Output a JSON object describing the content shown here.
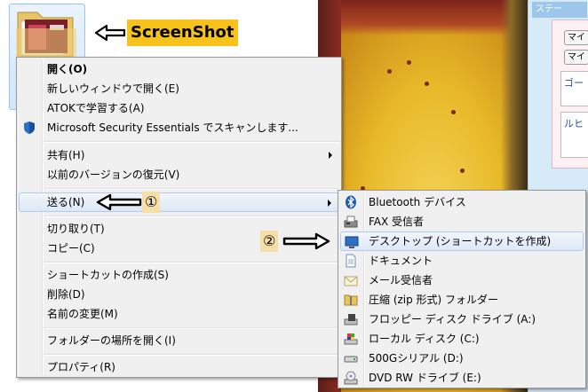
{
  "annotation": {
    "screenshot_label": "ScreenShot",
    "step1": "①",
    "step2": "②"
  },
  "side_panel": {
    "tab": "ステー",
    "btn1": "マイ",
    "btn2": "マイ",
    "box1": "ゴー",
    "box2": "ルヒ"
  },
  "context_menu": {
    "items": [
      {
        "label": "開く(O)"
      },
      {
        "label": "新しいウィンドウで開く(E)"
      },
      {
        "label": "ATOKで学習する(A)"
      },
      {
        "label": "Microsoft Security Essentials でスキャンします..."
      },
      {
        "label": "共有(H)"
      },
      {
        "label": "以前のバージョンの復元(V)"
      },
      {
        "label": "送る(N)"
      },
      {
        "label": "切り取り(T)"
      },
      {
        "label": "コピー(C)"
      },
      {
        "label": "ショートカットの作成(S)"
      },
      {
        "label": "削除(D)"
      },
      {
        "label": "名前の変更(M)"
      },
      {
        "label": "フォルダーの場所を開く(I)"
      },
      {
        "label": "プロパティ(R)"
      }
    ]
  },
  "sendto_menu": {
    "items": [
      {
        "label": "Bluetooth デバイス"
      },
      {
        "label": "FAX 受信者"
      },
      {
        "label": "デスクトップ (ショートカットを作成)"
      },
      {
        "label": "ドキュメント"
      },
      {
        "label": "メール受信者"
      },
      {
        "label": "圧縮 (zip 形式) フォルダー"
      },
      {
        "label": "フロッピー ディスク ドライブ (A:)"
      },
      {
        "label": "ローカル ディスク (C:)"
      },
      {
        "label": "500Gシリアル (D:)"
      },
      {
        "label": "DVD RW ドライブ (E:)"
      }
    ]
  },
  "colors": {
    "highlight_border": "#aeccf0",
    "label_bg": "#f7c21b",
    "step_bg": "#f5dfa6"
  }
}
